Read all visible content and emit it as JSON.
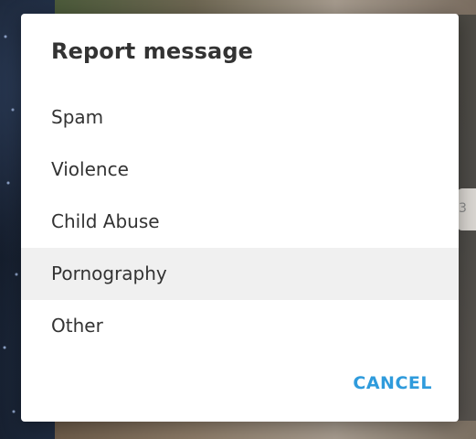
{
  "dialog": {
    "title": "Report message",
    "options": [
      {
        "label": "Spam"
      },
      {
        "label": "Violence"
      },
      {
        "label": "Child Abuse"
      },
      {
        "label": "Pornography",
        "hovered": true
      },
      {
        "label": "Other"
      }
    ],
    "cancel_label": "CANCEL"
  },
  "background": {
    "side_chip_text": "3"
  },
  "colors": {
    "accent": "#2f9bdc",
    "text": "#333333",
    "hover_row": "#f0f0f0"
  }
}
